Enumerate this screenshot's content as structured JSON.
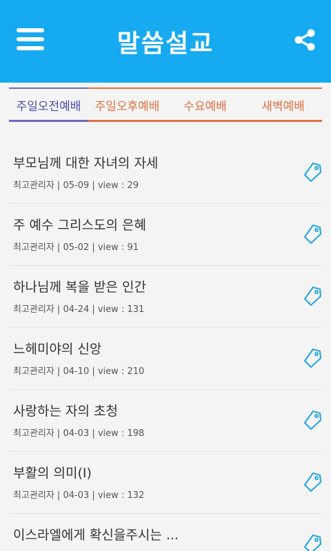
{
  "header": {
    "title": "말씀설교",
    "menu_icon": "hamburger-menu-icon",
    "share_icon": "share-icon"
  },
  "colors": {
    "header_bg": "#16aaf0",
    "tab_active": "#4a4fa8",
    "tab_inactive": "#e0703f",
    "tag_icon": "#29a8e0"
  },
  "tabs": [
    {
      "label": "주일오전예배",
      "active": true
    },
    {
      "label": "주일오후예배",
      "active": false
    },
    {
      "label": "수요예배",
      "active": false
    },
    {
      "label": "새벽예배",
      "active": false
    }
  ],
  "sermons": [
    {
      "title": "부모님께 대한 자녀의 자세",
      "meta": "최고관리자 | 05-09 | view : 29"
    },
    {
      "title": "주 예수 그리스도의 은혜",
      "meta": "최고관리자 | 05-02 | view : 91"
    },
    {
      "title": "하나님께 복을 받은 인간",
      "meta": "최고관리자 | 04-24 | view : 131"
    },
    {
      "title": "느헤미야의 신앙",
      "meta": "최고관리자 | 04-10 | view : 210"
    },
    {
      "title": "사랑하는 자의 초청",
      "meta": "최고관리자 | 04-03 | view : 198"
    },
    {
      "title": "부활의 의미(Ⅰ)",
      "meta": "최고관리자 | 04-03 | view : 132"
    },
    {
      "title": "이스라엘에게 확신을주시는 ...",
      "meta": ""
    }
  ]
}
